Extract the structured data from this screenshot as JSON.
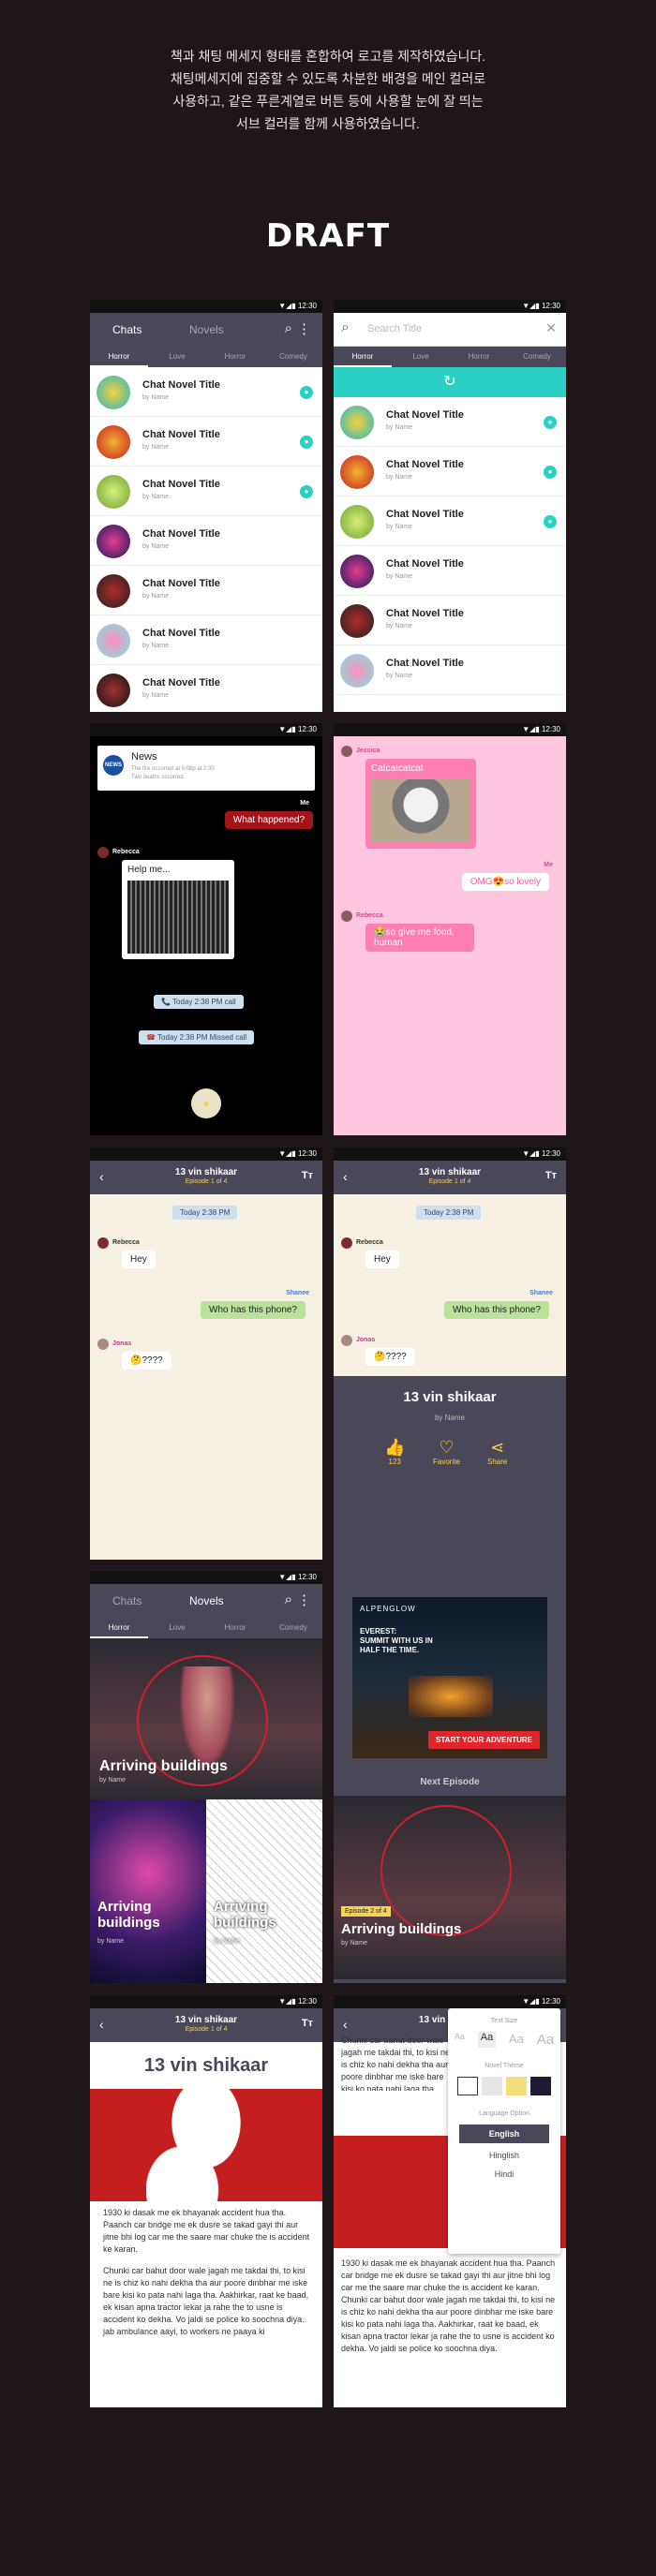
{
  "intro": {
    "line1": "책과 채팅 메세지 형태를 혼합하여 로고를 제작하였습니다.",
    "line2": "채팅메세지에 집중할 수 있도록 차분한 배경을 메인 컬러로",
    "line3": "사용하고, 같은 푸른계열로 버튼 등에 사용할 눈에 잘 띄는",
    "line4": "서브 컬러를 함께 사용하였습니다."
  },
  "draft": "DRAFT",
  "status": {
    "time": "12:30"
  },
  "nav": {
    "chats": "Chats",
    "novels": "Novels",
    "search_placeholder": "Search Title"
  },
  "tabs": [
    "Horror",
    "Love",
    "Horror",
    "Comedy"
  ],
  "novel_list": [
    {
      "title": "Chat Novel Title",
      "author": "by Name"
    },
    {
      "title": "Chat Novel Title",
      "author": "by Name"
    },
    {
      "title": "Chat Novel Title",
      "author": "by Name"
    },
    {
      "title": "Chat Novel Title",
      "author": "by Name"
    },
    {
      "title": "Chat Novel Title",
      "author": "by Name"
    },
    {
      "title": "Chat Novel Title",
      "author": "by Name"
    },
    {
      "title": "Chat Novel Title",
      "author": "by Name"
    }
  ],
  "horror_chat": {
    "news_title": "News",
    "news_line1": "The fire occurred at 5:08p at 2:30",
    "news_line2": "Two deaths occurred",
    "me": "Me",
    "msg_me": "What happened?",
    "rebecca": "Rebecca",
    "help": "Help me...",
    "call": "Today 2:38 PM call",
    "missed": "Today 2:38 PM Missed call"
  },
  "love_chat": {
    "sender": "Jessica",
    "cat": "Catcatcatcat",
    "me": "Me",
    "omg": "OMG😍so lovely",
    "rebecca": "Rebecca",
    "food": "😭so give me food, human"
  },
  "episode": {
    "title": "13 vin shikaar",
    "ep": "Episode 1 of 4",
    "today": "Today 2:38 PM",
    "rebecca": "Rebecca",
    "hey": "Hey",
    "shanee": "Shanee",
    "who": "Who has this phone?",
    "jonas": "Jonas",
    "q": "🤔????"
  },
  "end": {
    "title": "13 vin shikaar",
    "by": "by Name",
    "like_count": "123",
    "favorite": "Favorite",
    "share": "Share",
    "ad_brand": "ALPENGLOW",
    "ad_line1": "EVEREST:",
    "ad_line2": "SUMMIT WITH US IN",
    "ad_line3": "HALF THE TIME.",
    "ad_cta": "START YOUR ADVENTURE",
    "next": "Next Episode",
    "next_ep": "Episode 2 of 4",
    "next_title": "Arriving buildings",
    "next_by": "by Name"
  },
  "novels": {
    "hero_title": "Arriving buildings",
    "hero_by": "by Name",
    "card1": "Arriving buildings",
    "card1_by": "by Name",
    "card2": "Arriving buildings",
    "card2_by": "by Name"
  },
  "reader": {
    "title": "13 vin shikaar",
    "p1": "1930 ki dasak me ek  bhayanak accident hua tha. Paanch car  bridge me ek dusre se takad gayi thi aur jitne bhi log car me the saare mar chuke the is accident ke karan.",
    "p2": "Chunki car bahut door wale jagah me takdai thi, to kisi ne is chiz ko nahi dekha tha aur poore dinbhar me iske bare kisi ko pata nahi laga tha. Aakhirkar, raat ke baad, ek kisan apna tractor lekar ja rahe the to usne is accident ko dekha. Vo jaldi se police ko soochna diya.",
    "p3": "jab ambulance aayi, to workers ne paaya ki"
  },
  "settings": {
    "text_size": "Text Size",
    "sizes": [
      "Aa",
      "Aa",
      "Aa",
      "Aa"
    ],
    "novel_theme": "Novel Theme",
    "language": "Language Option",
    "langs": [
      "English",
      "Hinglish",
      "Hindi"
    ],
    "swatches": [
      "#ffffff",
      "#e6e6e6",
      "#f4df7a",
      "#1e1b35"
    ]
  },
  "colors": {
    "main": "#4a4758",
    "accent": "#2bd0c4",
    "bg": "#1e1619",
    "cream": "#f6f1e3",
    "pink": "#ff9ec4",
    "red": "#c41e1e"
  }
}
